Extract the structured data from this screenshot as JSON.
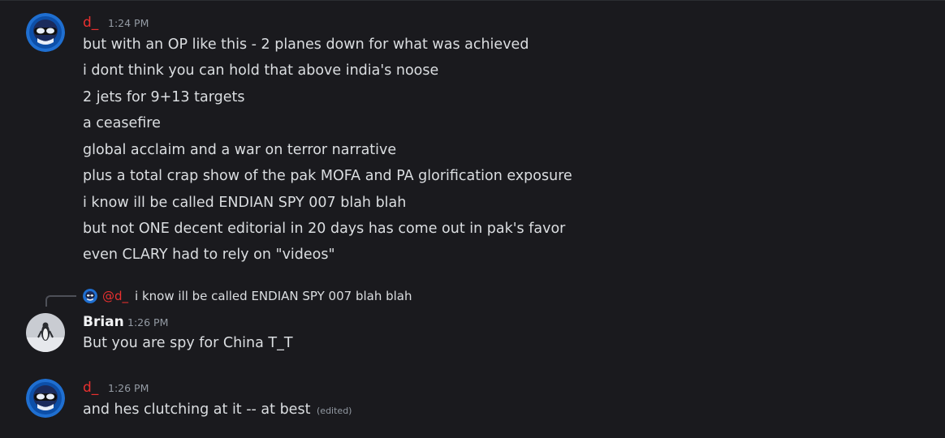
{
  "messages": [
    {
      "author": "d_",
      "time": "1:24 PM",
      "lines": [
        "but with an OP like this - 2 planes down for what was achieved",
        "i dont think you can hold that above india's noose",
        "2 jets for 9+13 targets",
        "a ceasefire",
        "global acclaim and a war on terror narrative",
        "plus a total crap show of the pak MOFA and PA glorification exposure",
        "i know ill be called ENDIAN SPY 007 blah blah",
        "but not ONE decent editorial in 20 days has come out in pak's favor",
        "even CLARY had to rely on \"videos\""
      ]
    },
    {
      "reply_to": {
        "mention": "@d_",
        "quote": "i know ill be called ENDIAN SPY 007 blah blah"
      },
      "author": "Brian",
      "time": "1:26 PM",
      "lines": [
        "But you are spy for China T_T"
      ]
    },
    {
      "author": "d_",
      "time": "1:26 PM",
      "lines": [
        "and hes clutching at it -- at best"
      ],
      "edited": "(edited)"
    }
  ],
  "colors": {
    "background": "#1a1a1e",
    "author_d": "#e9302f",
    "author_brian": "#f2f3f5",
    "timestamp": "#949ba4",
    "text": "#dbdee1"
  }
}
